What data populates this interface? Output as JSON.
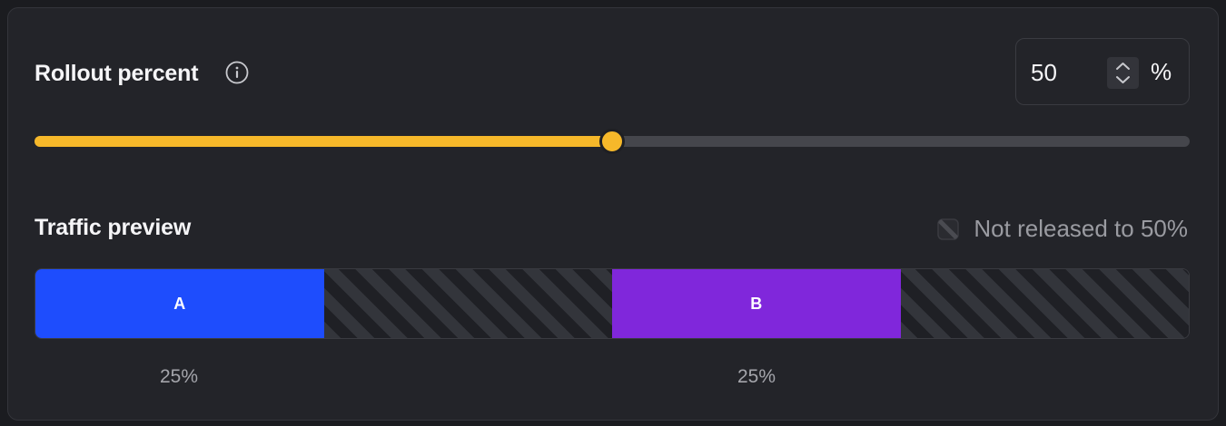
{
  "rollout": {
    "title": "Rollout percent",
    "info_icon": "info-icon",
    "value": "50",
    "unit": "%",
    "slider_value": 0.5,
    "stepper_icon": "chevron-up-down-icon",
    "accent_color": "#f6b82a"
  },
  "traffic": {
    "title": "Traffic preview",
    "legend_icon": "striped-square-icon",
    "legend_text": "Not released to 50%",
    "segments": [
      {
        "label": "A",
        "share": 0.25,
        "color": "#1e4dfd",
        "released": true,
        "percent": "25%"
      },
      {
        "label": "",
        "share": 0.25,
        "released": false
      },
      {
        "label": "B",
        "share": 0.25,
        "color": "#8027db",
        "released": true,
        "percent": "25%"
      },
      {
        "label": "",
        "share": 0.25,
        "released": false
      }
    ]
  }
}
